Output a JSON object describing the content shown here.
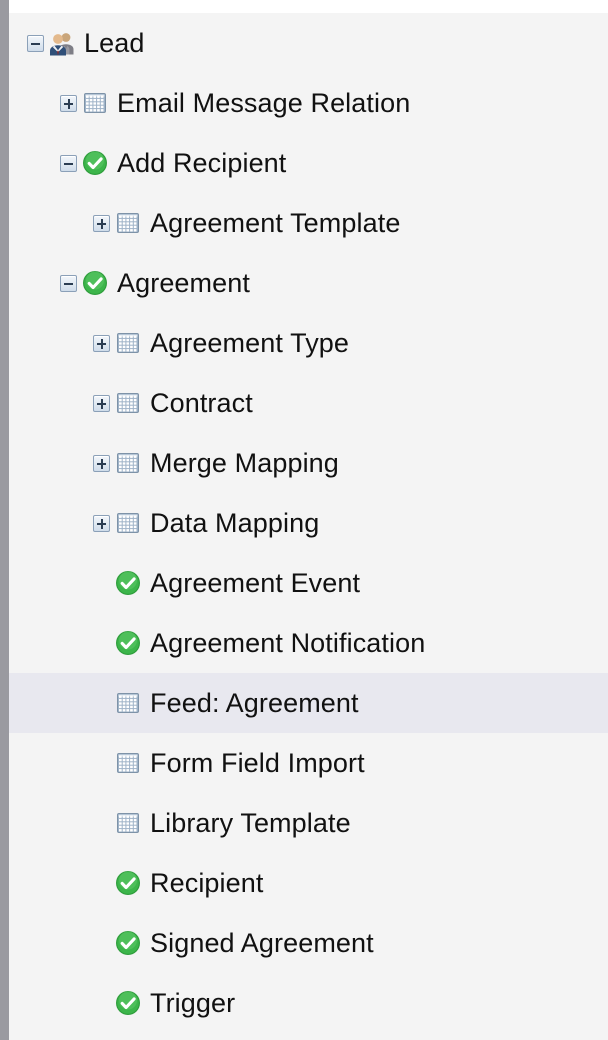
{
  "panel": {
    "name": "object-relationship-tree",
    "background_color": "#f4f4f4",
    "selected_row_color": "#e8e8ef",
    "scrollbar_color": "#9a9aa0"
  },
  "colors": {
    "check_green": "#3cb54a",
    "grid_blue_gray": "#9fb3c8",
    "toggle_border": "#8ba0b8",
    "text": "#111111"
  },
  "tree": {
    "rows": [
      {
        "label": "Lead",
        "depth": 0,
        "toggle": "minus",
        "icon": "people-icon",
        "selected": false
      },
      {
        "label": "Email Message Relation",
        "depth": 1,
        "toggle": "plus",
        "icon": "grid-table-icon",
        "selected": false
      },
      {
        "label": "Add Recipient",
        "depth": 1,
        "toggle": "minus",
        "icon": "green-check-icon",
        "selected": false
      },
      {
        "label": "Agreement Template",
        "depth": 2,
        "toggle": "plus",
        "icon": "grid-table-icon",
        "selected": false
      },
      {
        "label": "Agreement",
        "depth": 1,
        "toggle": "minus",
        "icon": "green-check-icon",
        "selected": false
      },
      {
        "label": "Agreement Type",
        "depth": 2,
        "toggle": "plus",
        "icon": "grid-table-icon",
        "selected": false
      },
      {
        "label": "Contract",
        "depth": 2,
        "toggle": "plus",
        "icon": "grid-table-icon",
        "selected": false
      },
      {
        "label": "Merge Mapping",
        "depth": 2,
        "toggle": "plus",
        "icon": "grid-table-icon",
        "selected": false
      },
      {
        "label": "Data Mapping",
        "depth": 2,
        "toggle": "plus",
        "icon": "grid-table-icon",
        "selected": false
      },
      {
        "label": "Agreement Event",
        "depth": 2,
        "toggle": "none",
        "icon": "green-check-icon",
        "selected": false
      },
      {
        "label": "Agreement Notification",
        "depth": 2,
        "toggle": "none",
        "icon": "green-check-icon",
        "selected": false
      },
      {
        "label": "Feed: Agreement",
        "depth": 2,
        "toggle": "none",
        "icon": "grid-table-icon",
        "selected": true
      },
      {
        "label": "Form Field Import",
        "depth": 2,
        "toggle": "none",
        "icon": "grid-table-icon",
        "selected": false
      },
      {
        "label": "Library Template",
        "depth": 2,
        "toggle": "none",
        "icon": "grid-table-icon",
        "selected": false
      },
      {
        "label": "Recipient",
        "depth": 2,
        "toggle": "none",
        "icon": "green-check-icon",
        "selected": false
      },
      {
        "label": "Signed Agreement",
        "depth": 2,
        "toggle": "none",
        "icon": "green-check-icon",
        "selected": false
      },
      {
        "label": "Trigger",
        "depth": 2,
        "toggle": "none",
        "icon": "green-check-icon",
        "selected": false
      }
    ]
  }
}
